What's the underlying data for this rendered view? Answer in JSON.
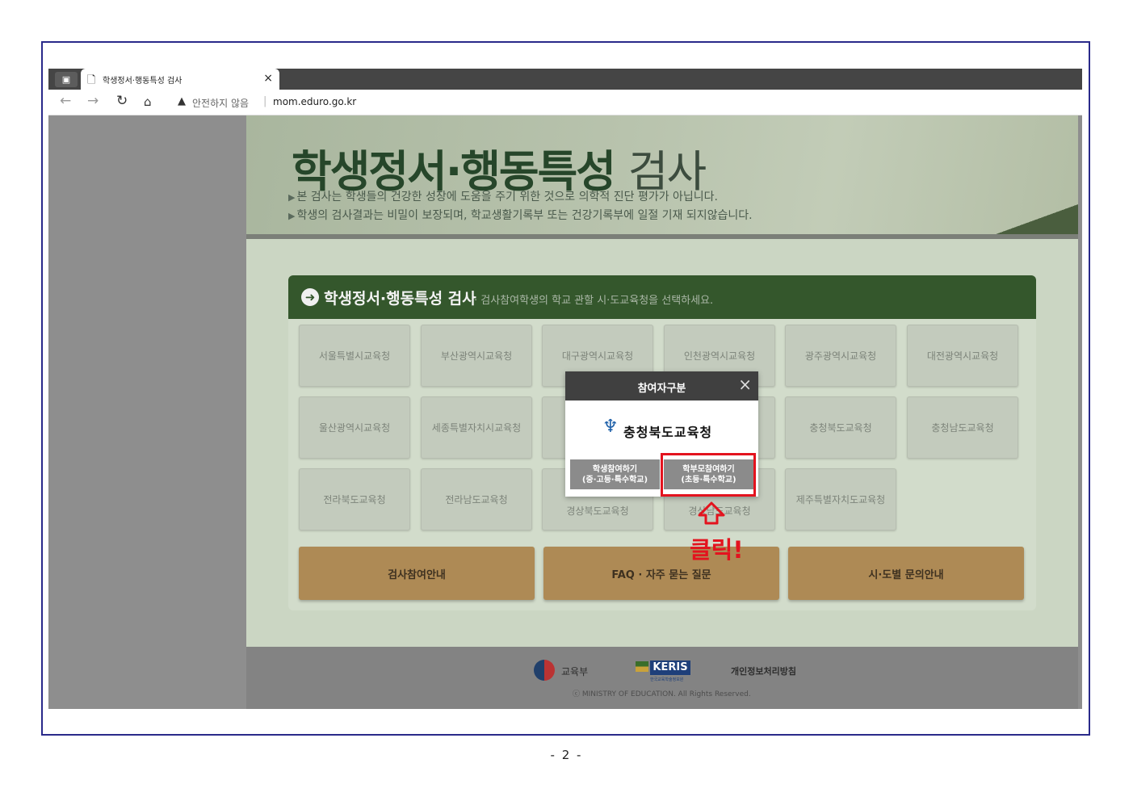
{
  "browser": {
    "tab_title": "학생정서·행동특성 검사",
    "tab_close": "×",
    "new_tab": "+",
    "security_warning": "안전하지 않음",
    "address_sep": "|",
    "url": "mom.eduro.go.kr",
    "icons": [
      "sidebar-icon",
      "page-icon",
      "back-icon",
      "forward-icon",
      "reload-icon",
      "home-icon",
      "warning-icon"
    ]
  },
  "hero": {
    "title_bold": "학생정서·행동특성",
    "title_light": "검사",
    "lines": [
      "본 검사는 학생들의 건강한 성장에 도움을 주기 위한 것으로 의학적 진단 평가가 아닙니다.",
      "학생의 검사결과는 비밀이 보장되며, 학교생활기록부 또는 건강기록부에 일절 기재 되지않습니다."
    ]
  },
  "panel": {
    "title": "학생정서·행동특성 검사",
    "subtitle": "· 검사참여학생의 학교 관할 시·도교육청을 선택하세요.",
    "offices": [
      [
        "서울특별시교육청",
        "부산광역시교육청",
        "대구광역시교육청",
        "인천광역시교육청",
        "광주광역시교육청",
        "대전광역시교육청"
      ],
      [
        "울산광역시교육청",
        "세종특별자치시교육청",
        "",
        "",
        "충청북도교육청",
        "충청남도교육청"
      ],
      [
        "전라북도교육청",
        "전라남도교육청",
        "경상북도교육청",
        "경상남도교육청",
        "제주특별자치도교육청"
      ]
    ],
    "buttons": [
      "검사참여안내",
      "FAQ · 자주 묻는 질문",
      "시·도별 문의안내"
    ]
  },
  "modal": {
    "title": "참여자구분",
    "close": "×",
    "org_name": "충청북도교육청",
    "student_btn": [
      "학생참여하기",
      "(중·고등·특수학교)"
    ],
    "parent_btn": [
      "학부모참여하기",
      "(초등·특수학교)"
    ]
  },
  "annotation": {
    "click_label": "클릭!",
    "color": "#e3131e"
  },
  "footer": {
    "ministry": "교육부",
    "keris": "KERIS",
    "keris_sub": "한국교육학술정보원",
    "privacy": "개인정보처리방침",
    "copyright": "ⓒ MINISTRY OF EDUCATION. All Rights Reserved."
  },
  "page_number": "- 2 -",
  "colors": {
    "header_green": "#34572c",
    "button_gold": "#ae8a55",
    "frame_border": "#2a2a8a"
  }
}
